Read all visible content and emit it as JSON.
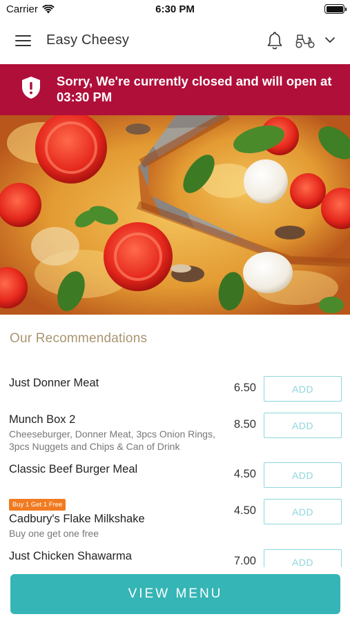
{
  "status_bar": {
    "carrier": "Carrier",
    "time": "6:30 PM"
  },
  "header": {
    "title": "Easy Cheesy",
    "icons": [
      "hamburger-menu-icon",
      "bell-icon",
      "scooter-icon",
      "chevron-down-icon"
    ]
  },
  "banner": {
    "message": "Sorry, We're currently closed and will open at 03:30 PM",
    "icon": "shield-alert-icon",
    "color": "#b00f3a"
  },
  "hero": {
    "image": "pizza-photo"
  },
  "recommendations": {
    "title": "Our Recommendations",
    "items": [
      {
        "name": "Just Donner Meat",
        "description": "",
        "price": "6.50",
        "button": "ADD",
        "badge": ""
      },
      {
        "name": "Munch Box 2",
        "description": "Cheeseburger, Donner Meat, 3pcs Onion Rings, 3pcs Nuggets and Chips & Can of Drink",
        "price": "8.50",
        "button": "ADD",
        "badge": ""
      },
      {
        "name": "Classic Beef Burger Meal",
        "description": "",
        "price": "4.50",
        "button": "ADD",
        "badge": ""
      },
      {
        "name": "Cadbury's Flake Milkshake",
        "description": "Buy one get one free",
        "price": "4.50",
        "button": "ADD",
        "badge": "Buy 1 Get 1 Free"
      },
      {
        "name": "Just Chicken Shawarma",
        "description": "",
        "price": "7.00",
        "button": "ADD",
        "badge": ""
      }
    ]
  },
  "footer": {
    "button": "VIEW MENU",
    "color": "#36b5b6"
  },
  "colors": {
    "accent": "#36b5b6",
    "add_button": "#8ed6da",
    "section_title": "#a99470",
    "badge": "#f07b20"
  }
}
